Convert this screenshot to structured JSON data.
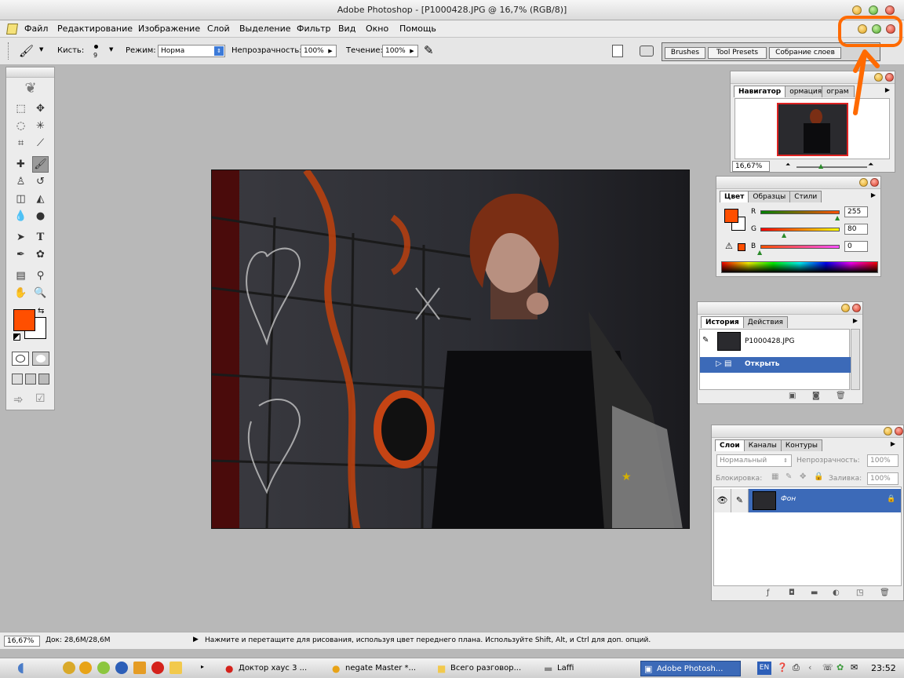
{
  "window": {
    "title": "Adobe Photoshop - [P1000428.JPG @ 16,7% (RGB/8)]"
  },
  "menu": [
    "Файл",
    "Редактирование",
    "Изображение",
    "Слой",
    "Выделение",
    "Фильтр",
    "Вид",
    "Окно",
    "Помощь"
  ],
  "options": {
    "brush_label": "Кисть:",
    "brush_size": "9",
    "mode_label": "Режим:",
    "mode_value": "Норма",
    "opacity_label": "Непрозрачность:",
    "opacity_value": "100%",
    "flow_label": "Течение:",
    "flow_value": "100%"
  },
  "well_tabs": [
    "Brushes",
    "Tool Presets",
    "Собрание слоев"
  ],
  "colors": {
    "foreground": "#ff4f00",
    "background": "#ffffff",
    "annotation": "#ff6a00"
  },
  "navigator": {
    "tabs": [
      "Навигатор",
      "ормация",
      "ограм"
    ],
    "zoom": "16,67%"
  },
  "color_panel": {
    "tabs": [
      "Цвет",
      "Образцы",
      "Стили"
    ],
    "r_label": "R",
    "r_value": "255",
    "g_label": "G",
    "g_value": "80",
    "b_label": "B",
    "b_value": "0"
  },
  "history": {
    "tabs": [
      "История",
      "Действия"
    ],
    "snapshot": "P1000428.JPG",
    "step": "Открыть"
  },
  "layers": {
    "tabs": [
      "Слои",
      "Каналы",
      "Контуры"
    ],
    "blend_mode": "Нормальный",
    "opacity_label": "Непрозрачность:",
    "opacity_value": "100%",
    "lock_label": "Блокировка:",
    "fill_label": "Заливка:",
    "fill_value": "100%",
    "layer_name": "Фон"
  },
  "status": {
    "zoom": "16,67%",
    "doc": "Док: 28,6M/28,6M",
    "hint": "Нажмите и перетащите для рисования, используя цвет переднего плана. Используйте Shift, Alt, и Ctrl для доп. опций."
  },
  "taskbar": {
    "items": [
      "Доктор хаус 3 ...",
      "negate Master *...",
      "Всего разговор...",
      "Laffi",
      "Adobe Photosh..."
    ],
    "lang": "EN",
    "time": "23:52"
  }
}
